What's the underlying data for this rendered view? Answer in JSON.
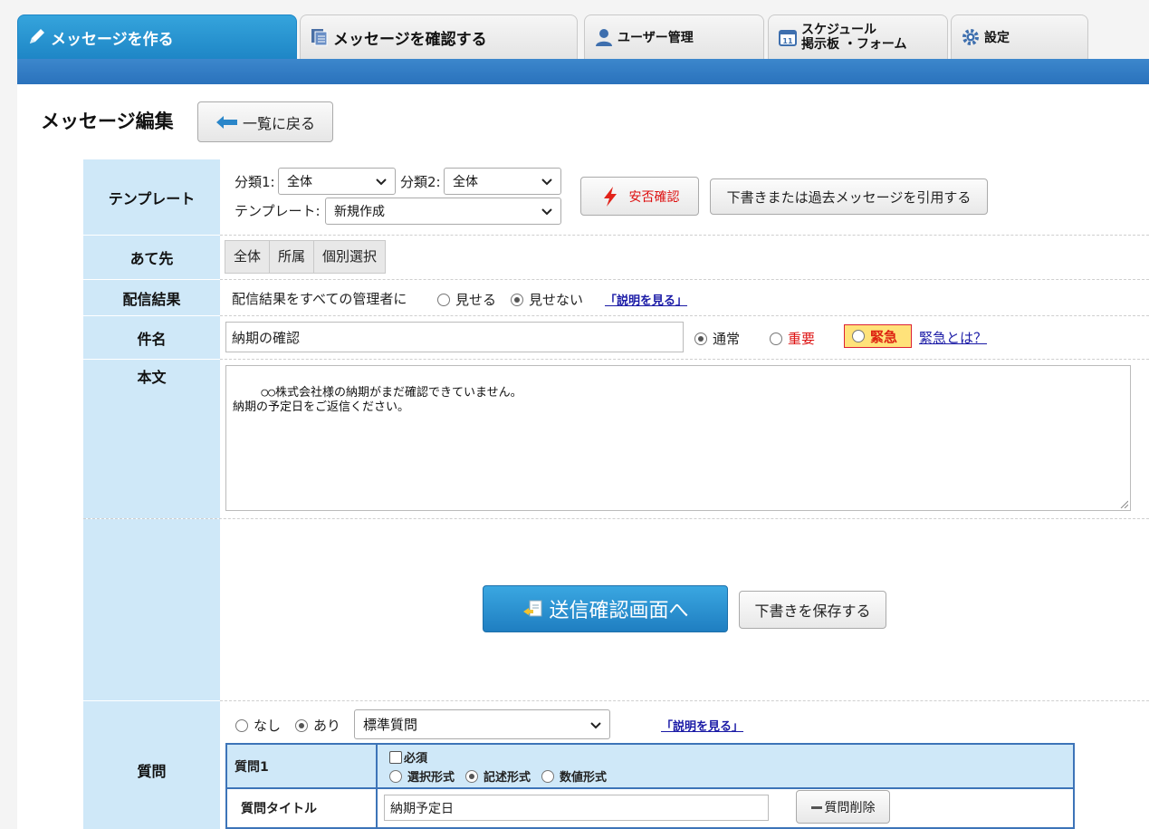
{
  "tabs": [
    {
      "label": "メッセージを作る",
      "icon": "pencil-icon"
    },
    {
      "label": "メッセージを確認する",
      "icon": "documents-icon"
    },
    {
      "label": "ユーザー管理",
      "icon": "user-icon"
    },
    {
      "label_line1": "スケジュール",
      "label_line2": "掲示板 ・フォーム",
      "icon": "calendar-icon"
    },
    {
      "label": "設定",
      "icon": "gear-icon"
    }
  ],
  "page": {
    "title": "メッセージ編集",
    "back_label": "一覧に戻る"
  },
  "template": {
    "row_label": "テンプレート",
    "cat1_label": "分類1:",
    "cat1_value": "全体",
    "cat2_label": "分類2:",
    "cat2_value": "全体",
    "template_label": "テンプレート:",
    "template_value": "新規作成",
    "safety_button": "安否確認",
    "quote_button": "下書きまたは過去メッセージを引用する"
  },
  "recipients": {
    "row_label": "あて先",
    "options": [
      "全体",
      "所属",
      "個別選択"
    ]
  },
  "delivery": {
    "row_label": "配信結果",
    "text": "配信結果をすべての管理者に",
    "show": "見せる",
    "hide": "見せない",
    "help_link": "「説明を見る」"
  },
  "subject": {
    "row_label": "件名",
    "value": "納期の確認",
    "normal": "通常",
    "important": "重要",
    "urgent": "緊急",
    "urgent_help": "緊急とは？"
  },
  "body": {
    "row_label": "本文",
    "text": "○○株式会社様の納期がまだ確認できていません。\n納期の予定日をご返信ください。"
  },
  "actions": {
    "send_label": "送信確認画面へ",
    "save_draft_label": "下書きを保存する"
  },
  "question": {
    "row_label": "質問",
    "none": "なし",
    "yes": "あり",
    "type_value": "標準質問",
    "help_link": "「説明を見る」",
    "q1_label": "質問1",
    "required": "必須",
    "formats": [
      "選択形式",
      "記述形式",
      "数値形式"
    ],
    "title_label": "質問タイトル",
    "title_value": "納期予定日",
    "delete_label": "質問削除"
  },
  "colors": {
    "accent": "#2a86c9",
    "side_bg": "#cfe8f8",
    "urgent_bg": "#ffe27a",
    "important_red": "#dd1111"
  }
}
